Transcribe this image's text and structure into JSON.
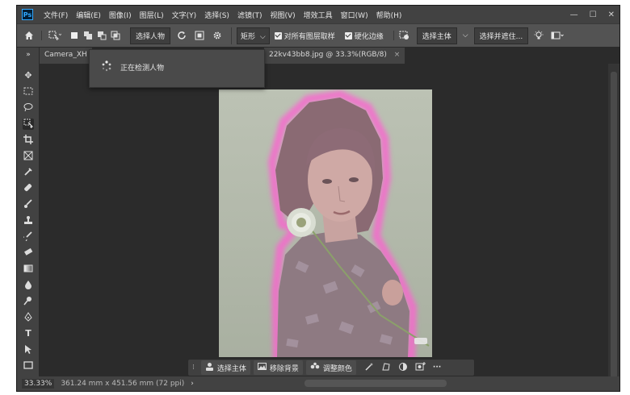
{
  "app": {
    "logo": "Ps"
  },
  "menu": [
    "文件(F)",
    "编辑(E)",
    "图像(I)",
    "图层(L)",
    "文字(Y)",
    "选择(S)",
    "滤镜(T)",
    "视图(V)",
    "增效工具",
    "窗口(W)",
    "帮助(H)"
  ],
  "window_controls": {
    "minimize": "—",
    "maximize": "☐",
    "close": "✕"
  },
  "options": {
    "subject_dropdown": "选择人物",
    "mode_dropdown": "矩形",
    "sample_all_layers": "对所有图层取样",
    "sample_all_checked": true,
    "harden_edges": "硬化边缘",
    "harden_checked": true,
    "select_subject_button": "选择主体",
    "select_mask_button": "选择并遮住..."
  },
  "tabs": {
    "left_tab": "Camera_XH",
    "doc_tab": "22kv43bb8.jpg @ 33.3%(RGB/8)",
    "doc_tab_close": "×"
  },
  "popup": {
    "text": "正在检测人物"
  },
  "contextual_taskbar": {
    "select_subject": "选择主体",
    "remove_background": "移除背景",
    "adjust_color": "调整颜色",
    "more": "···"
  },
  "status": {
    "zoom": "33.33%",
    "dimensions": "361.24 mm x 451.56 mm (72 ppi)",
    "arrow": "›"
  },
  "collapse_glyph": "»",
  "colors": {
    "app_bg": "#2b2b2b",
    "panel": "#424242",
    "selection_glow": "#ff5fd2"
  }
}
